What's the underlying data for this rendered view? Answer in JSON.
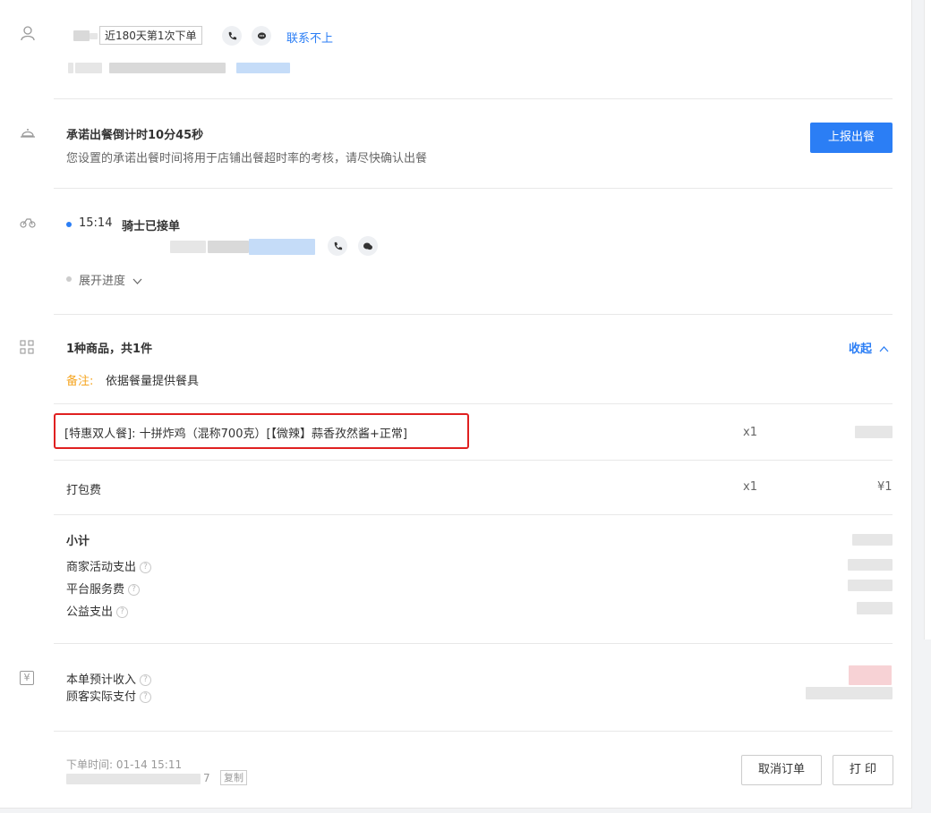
{
  "customer": {
    "tag": "近180天第1次下单",
    "contact_fail": "联系不上"
  },
  "promise": {
    "title": "承诺出餐倒计时10分45秒",
    "desc": "您设置的承诺出餐时间将用于店铺出餐超时率的考核，请尽快确认出餐",
    "report_button": "上报出餐"
  },
  "rider": {
    "time": "15:14",
    "status": "骑士已接单",
    "expand": "展开进度"
  },
  "goods": {
    "summary": "1种商品，共1件",
    "collapse": "收起",
    "remark_label": "备注:",
    "remark_text": "依据餐量提供餐具",
    "items": [
      {
        "name": "[特惠双人餐]: 十拼炸鸡（混称700克）[【微辣】蒜香孜然酱+正常]",
        "qty": "x1"
      },
      {
        "name": "打包费",
        "qty": "x1",
        "price": "¥1"
      }
    ],
    "subtotal": "小计",
    "fees": [
      {
        "label": "商家活动支出"
      },
      {
        "label": "平台服务费"
      },
      {
        "label": "公益支出"
      }
    ]
  },
  "income": {
    "expected": "本单预计收入",
    "actual_paid": "顾客实际支付"
  },
  "footer": {
    "order_time": "下单时间: 01-14 15:11",
    "order_no_tail": "7",
    "copy": "复制",
    "cancel_button": "取消订单",
    "print_button": "打 印"
  },
  "colors": {
    "accent": "#2b7ef5",
    "remark": "#f5a623",
    "highlight_border": "#e02020"
  }
}
